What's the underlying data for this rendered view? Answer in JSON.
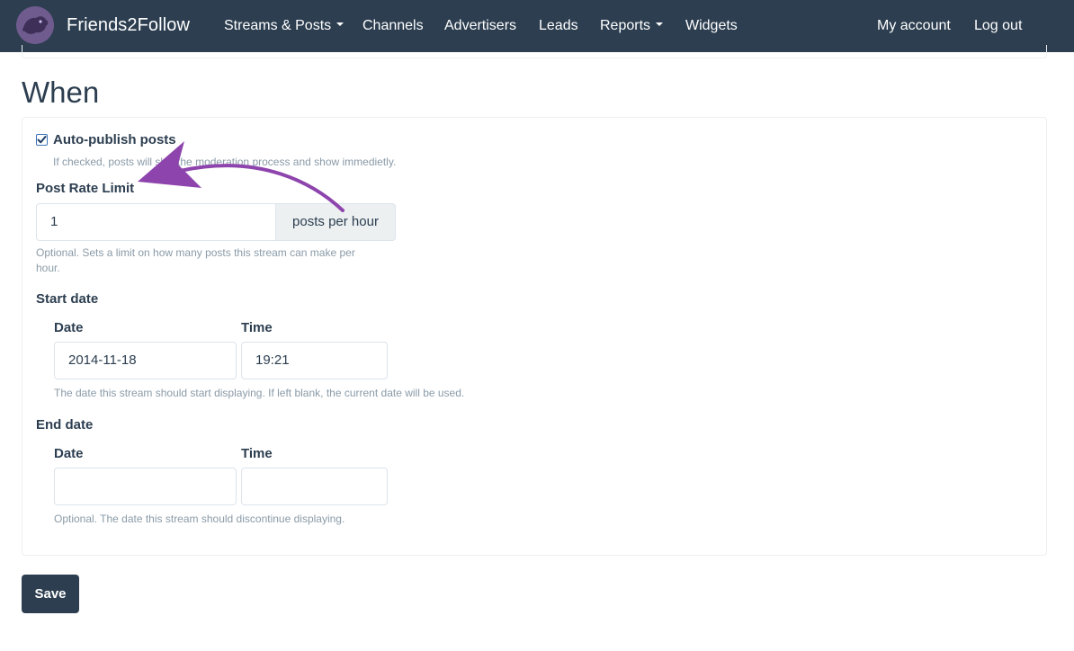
{
  "navbar": {
    "brand": "Friends2Follow",
    "items": [
      {
        "label": "Streams & Posts",
        "dropdown": true
      },
      {
        "label": "Channels",
        "dropdown": false
      },
      {
        "label": "Advertisers",
        "dropdown": false
      },
      {
        "label": "Leads",
        "dropdown": false
      },
      {
        "label": "Reports",
        "dropdown": true
      },
      {
        "label": "Widgets",
        "dropdown": false
      }
    ],
    "right_items": [
      {
        "label": "My account"
      },
      {
        "label": "Log out"
      }
    ]
  },
  "section": {
    "title": "When"
  },
  "auto_publish": {
    "label": "Auto-publish posts",
    "checked": true,
    "help": "If checked, posts will skip the moderation process and show immedietly."
  },
  "post_rate": {
    "label": "Post Rate Limit",
    "value": "1",
    "addon": "posts per hour",
    "help_line1": "Optional. Sets a limit on how many posts this stream can make per",
    "help_line2": "hour."
  },
  "start_date": {
    "label": "Start date",
    "date_label": "Date",
    "time_label": "Time",
    "date_value": "2014-11-18",
    "time_value": "19:21",
    "help": "The date this stream should start displaying. If left blank, the current date will be used."
  },
  "end_date": {
    "label": "End date",
    "date_label": "Date",
    "time_label": "Time",
    "date_value": "",
    "time_value": "",
    "help": "Optional. The date this stream should discontinue displaying."
  },
  "save_label": "Save",
  "colors": {
    "navbar": "#2c3e50",
    "annotation_arrow": "#8e44ad",
    "addon_bg": "#ecf0f1"
  }
}
